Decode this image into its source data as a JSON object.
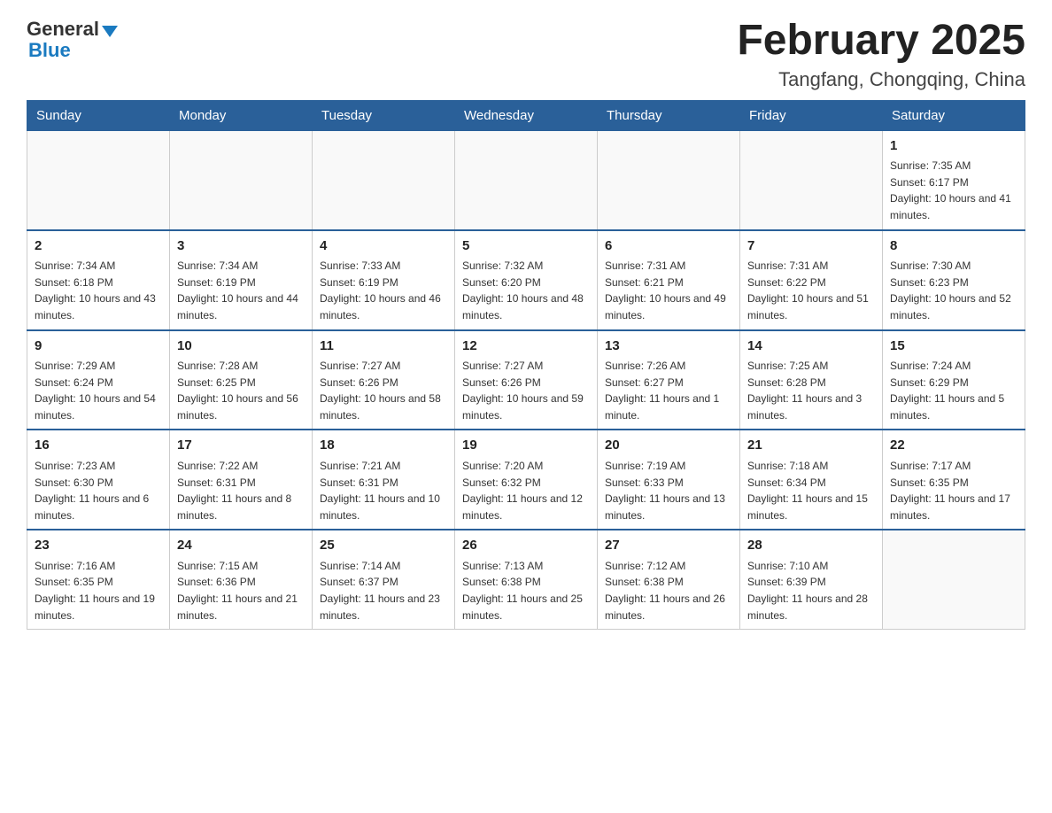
{
  "header": {
    "logo_general": "General",
    "logo_blue": "Blue",
    "month_title": "February 2025",
    "location": "Tangfang, Chongqing, China"
  },
  "weekdays": [
    "Sunday",
    "Monday",
    "Tuesday",
    "Wednesday",
    "Thursday",
    "Friday",
    "Saturday"
  ],
  "weeks": [
    [
      {
        "day": "",
        "info": ""
      },
      {
        "day": "",
        "info": ""
      },
      {
        "day": "",
        "info": ""
      },
      {
        "day": "",
        "info": ""
      },
      {
        "day": "",
        "info": ""
      },
      {
        "day": "",
        "info": ""
      },
      {
        "day": "1",
        "info": "Sunrise: 7:35 AM\nSunset: 6:17 PM\nDaylight: 10 hours and 41 minutes."
      }
    ],
    [
      {
        "day": "2",
        "info": "Sunrise: 7:34 AM\nSunset: 6:18 PM\nDaylight: 10 hours and 43 minutes."
      },
      {
        "day": "3",
        "info": "Sunrise: 7:34 AM\nSunset: 6:19 PM\nDaylight: 10 hours and 44 minutes."
      },
      {
        "day": "4",
        "info": "Sunrise: 7:33 AM\nSunset: 6:19 PM\nDaylight: 10 hours and 46 minutes."
      },
      {
        "day": "5",
        "info": "Sunrise: 7:32 AM\nSunset: 6:20 PM\nDaylight: 10 hours and 48 minutes."
      },
      {
        "day": "6",
        "info": "Sunrise: 7:31 AM\nSunset: 6:21 PM\nDaylight: 10 hours and 49 minutes."
      },
      {
        "day": "7",
        "info": "Sunrise: 7:31 AM\nSunset: 6:22 PM\nDaylight: 10 hours and 51 minutes."
      },
      {
        "day": "8",
        "info": "Sunrise: 7:30 AM\nSunset: 6:23 PM\nDaylight: 10 hours and 52 minutes."
      }
    ],
    [
      {
        "day": "9",
        "info": "Sunrise: 7:29 AM\nSunset: 6:24 PM\nDaylight: 10 hours and 54 minutes."
      },
      {
        "day": "10",
        "info": "Sunrise: 7:28 AM\nSunset: 6:25 PM\nDaylight: 10 hours and 56 minutes."
      },
      {
        "day": "11",
        "info": "Sunrise: 7:27 AM\nSunset: 6:26 PM\nDaylight: 10 hours and 58 minutes."
      },
      {
        "day": "12",
        "info": "Sunrise: 7:27 AM\nSunset: 6:26 PM\nDaylight: 10 hours and 59 minutes."
      },
      {
        "day": "13",
        "info": "Sunrise: 7:26 AM\nSunset: 6:27 PM\nDaylight: 11 hours and 1 minute."
      },
      {
        "day": "14",
        "info": "Sunrise: 7:25 AM\nSunset: 6:28 PM\nDaylight: 11 hours and 3 minutes."
      },
      {
        "day": "15",
        "info": "Sunrise: 7:24 AM\nSunset: 6:29 PM\nDaylight: 11 hours and 5 minutes."
      }
    ],
    [
      {
        "day": "16",
        "info": "Sunrise: 7:23 AM\nSunset: 6:30 PM\nDaylight: 11 hours and 6 minutes."
      },
      {
        "day": "17",
        "info": "Sunrise: 7:22 AM\nSunset: 6:31 PM\nDaylight: 11 hours and 8 minutes."
      },
      {
        "day": "18",
        "info": "Sunrise: 7:21 AM\nSunset: 6:31 PM\nDaylight: 11 hours and 10 minutes."
      },
      {
        "day": "19",
        "info": "Sunrise: 7:20 AM\nSunset: 6:32 PM\nDaylight: 11 hours and 12 minutes."
      },
      {
        "day": "20",
        "info": "Sunrise: 7:19 AM\nSunset: 6:33 PM\nDaylight: 11 hours and 13 minutes."
      },
      {
        "day": "21",
        "info": "Sunrise: 7:18 AM\nSunset: 6:34 PM\nDaylight: 11 hours and 15 minutes."
      },
      {
        "day": "22",
        "info": "Sunrise: 7:17 AM\nSunset: 6:35 PM\nDaylight: 11 hours and 17 minutes."
      }
    ],
    [
      {
        "day": "23",
        "info": "Sunrise: 7:16 AM\nSunset: 6:35 PM\nDaylight: 11 hours and 19 minutes."
      },
      {
        "day": "24",
        "info": "Sunrise: 7:15 AM\nSunset: 6:36 PM\nDaylight: 11 hours and 21 minutes."
      },
      {
        "day": "25",
        "info": "Sunrise: 7:14 AM\nSunset: 6:37 PM\nDaylight: 11 hours and 23 minutes."
      },
      {
        "day": "26",
        "info": "Sunrise: 7:13 AM\nSunset: 6:38 PM\nDaylight: 11 hours and 25 minutes."
      },
      {
        "day": "27",
        "info": "Sunrise: 7:12 AM\nSunset: 6:38 PM\nDaylight: 11 hours and 26 minutes."
      },
      {
        "day": "28",
        "info": "Sunrise: 7:10 AM\nSunset: 6:39 PM\nDaylight: 11 hours and 28 minutes."
      },
      {
        "day": "",
        "info": ""
      }
    ]
  ]
}
